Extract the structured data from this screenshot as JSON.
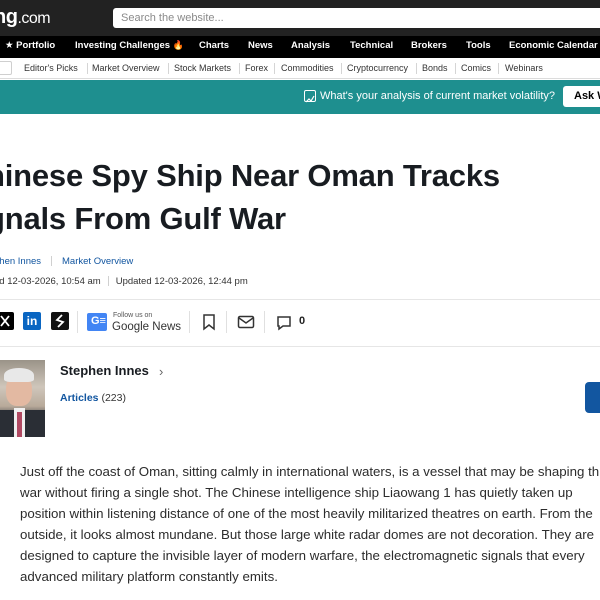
{
  "header": {
    "logo_main": "ng",
    "logo_domain": ".com",
    "search_placeholder": "Search the website..."
  },
  "main_nav": {
    "items": [
      {
        "label": "★ Portfolio"
      },
      {
        "label": "Investing Challenges"
      },
      {
        "label": "Charts"
      },
      {
        "label": "News"
      },
      {
        "label": "Analysis"
      },
      {
        "label": "Technical"
      },
      {
        "label": "Brokers"
      },
      {
        "label": "Tools"
      },
      {
        "label": "Economic Calendar"
      }
    ],
    "challenge_icon": "fire-icon"
  },
  "sub_nav": {
    "items": [
      {
        "label": "Editor's Picks"
      },
      {
        "label": "Market Overview"
      },
      {
        "label": "Stock Markets"
      },
      {
        "label": "Forex"
      },
      {
        "label": "Commodities"
      },
      {
        "label": "Cryptocurrency"
      },
      {
        "label": "Bonds"
      },
      {
        "label": "Comics"
      },
      {
        "label": "Webinars"
      }
    ]
  },
  "banner": {
    "icon": "chart-icon",
    "text": "What's your analysis of current market volatility?",
    "button": "Ask W"
  },
  "article": {
    "title_line1": "hinese Spy Ship Near Oman Tracks",
    "title_line2": "gnals From Gulf War",
    "author_link": "phen Innes",
    "category_link": "Market Overview",
    "published": "ed 12-03-2026, 10:54 am",
    "updated": "Updated 12-03-2026, 12:44 pm",
    "body": "Just off the coast of Oman, sitting calmly in international waters, is a vessel that may be shaping this war without firing a single shot. The Chinese intelligence ship Liaowang 1 has quietly taken up position within listening distance of one of the most heavily militarized theatres on earth. From the outside, it looks almost mundane. But those large white radar domes are not decoration. They are designed to capture the invisible layer of modern warfare, the electromagnetic signals that every advanced military platform constantly emits."
  },
  "share": {
    "google_follow_small": "Follow us on",
    "google_follow_big": "Google News",
    "comment_count": "0"
  },
  "author_card": {
    "name": "Stephen Innes",
    "articles_label": "Articles",
    "articles_count": "(223)"
  },
  "colors": {
    "header_bg": "#222222",
    "nav_bg": "#000000",
    "banner_bg": "#1e8f8f",
    "link": "#1256a0"
  }
}
